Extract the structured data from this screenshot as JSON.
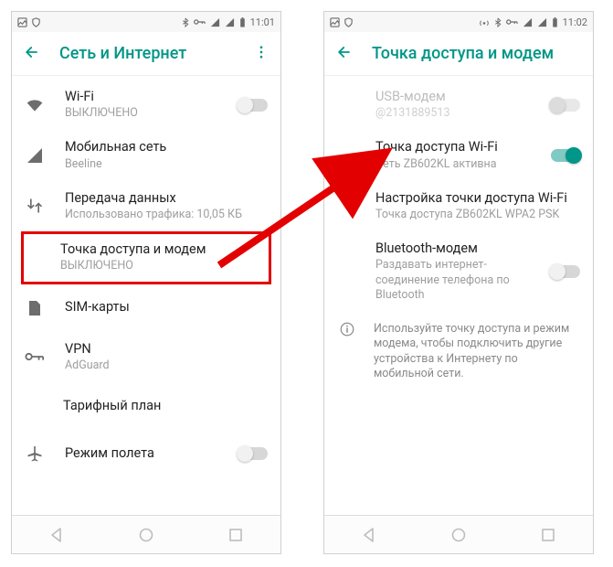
{
  "statusbar": {
    "time_left": "11:01",
    "time_right": "11:02"
  },
  "left": {
    "title": "Сеть и Интернет",
    "items": [
      {
        "id": "wifi",
        "primary": "Wi-Fi",
        "secondary": "ВЫКЛЮЧЕНО",
        "icon": "wifi",
        "toggle": "off"
      },
      {
        "id": "mobile",
        "primary": "Мобильная сеть",
        "secondary": "Beeline",
        "icon": "signal"
      },
      {
        "id": "data",
        "primary": "Передача данных",
        "secondary": "Использовано трафика: 10,05 КБ",
        "icon": "swap"
      },
      {
        "id": "hotspot",
        "primary": "Точка доступа и модем",
        "secondary": "ВЫКЛЮЧЕНО",
        "icon": "hotspot",
        "highlight": true
      },
      {
        "id": "sim",
        "primary": "SIM-карты",
        "secondary": "",
        "icon": "sim"
      },
      {
        "id": "vpn",
        "primary": "VPN",
        "secondary": "AdGuard",
        "icon": "vpn"
      },
      {
        "id": "plan",
        "primary": "Тарифный план",
        "secondary": "",
        "icon": null
      },
      {
        "id": "airplane",
        "primary": "Режим полета",
        "secondary": "",
        "icon": "plane",
        "toggle": "off"
      }
    ]
  },
  "right": {
    "title": "Точка доступа и модем",
    "items": [
      {
        "id": "usb",
        "primary": "USB-модем",
        "secondary": "@2131889513",
        "toggle": "disabled",
        "disabled": true
      },
      {
        "id": "wifiap",
        "primary": "Точка доступа Wi-Fi",
        "secondary": "Сеть ZB602KL активна",
        "toggle": "on"
      },
      {
        "id": "wifiapcfg",
        "primary": "Настройка точки доступа Wi-Fi",
        "secondary": "Точка доступа ZB602KL WPA2 PSK"
      },
      {
        "id": "bt",
        "primary": "Bluetooth-модем",
        "secondary": "Раздавать интернет-соединение телефона по Bluetooth",
        "toggle": "off"
      }
    ],
    "info": "Используйте точку доступа и режим модема, чтобы подключить другие устройства к Интернету по мобильной сети."
  }
}
